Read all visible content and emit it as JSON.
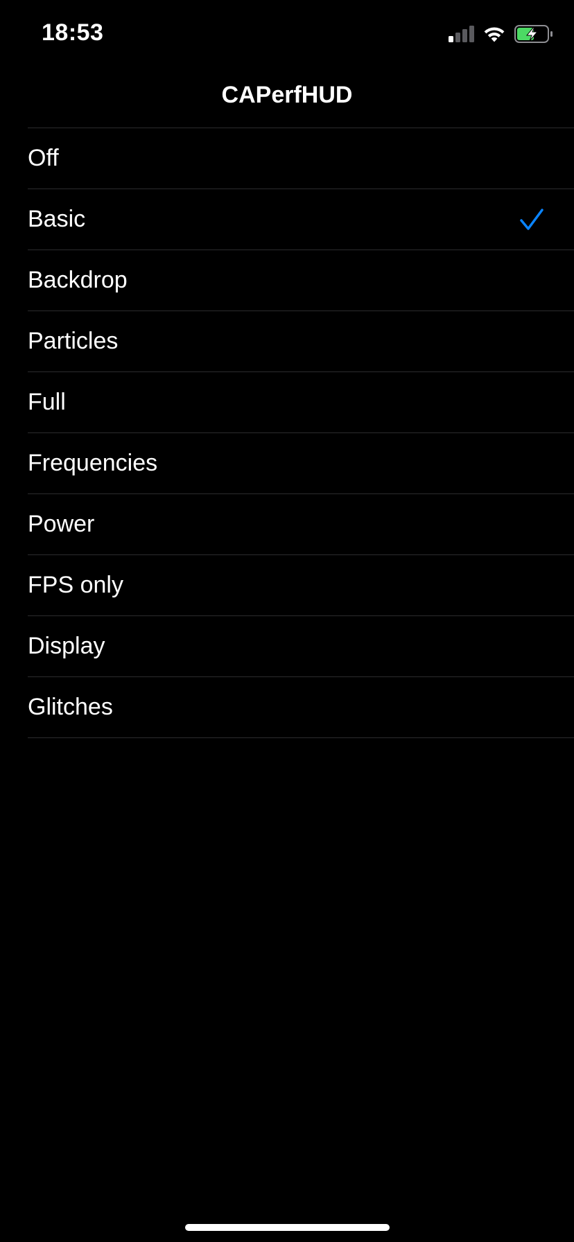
{
  "status_bar": {
    "time": "18:53",
    "signal_icon": "cellular-signal-icon",
    "signal_bars_active": 1,
    "signal_bars_total": 4,
    "wifi_icon": "wifi-icon",
    "battery_icon": "battery-charging-icon",
    "battery_color": "#4cd964"
  },
  "nav": {
    "title": "CAPerfHUD"
  },
  "options": [
    {
      "label": "Off",
      "selected": false
    },
    {
      "label": "Basic",
      "selected": true
    },
    {
      "label": "Backdrop",
      "selected": false
    },
    {
      "label": "Particles",
      "selected": false
    },
    {
      "label": "Full",
      "selected": false
    },
    {
      "label": "Frequencies",
      "selected": false
    },
    {
      "label": "Power",
      "selected": false
    },
    {
      "label": "FPS only",
      "selected": false
    },
    {
      "label": "Display",
      "selected": false
    },
    {
      "label": "Glitches",
      "selected": false
    }
  ],
  "colors": {
    "background": "#000000",
    "text": "#ffffff",
    "separator": "#2c2c2e",
    "checkmark": "#0a84ff"
  }
}
